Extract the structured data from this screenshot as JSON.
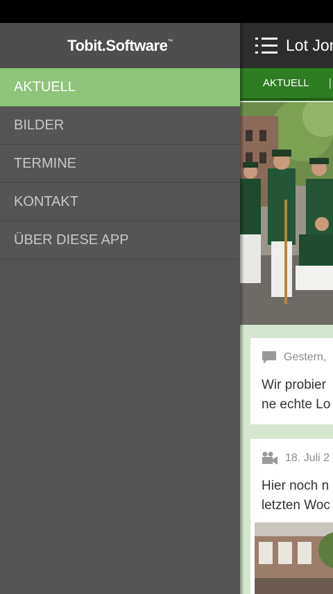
{
  "drawer": {
    "brand": "Tobit.Software",
    "brand_mark": "™",
    "items": [
      {
        "label": "AKTUELL",
        "active": true
      },
      {
        "label": "BILDER",
        "active": false
      },
      {
        "label": "TERMINE",
        "active": false
      },
      {
        "label": "KONTAKT",
        "active": false
      },
      {
        "label": "ÜBER DIESE APP",
        "active": false
      }
    ]
  },
  "appbar": {
    "menu_icon": "hamburger-menu-icon",
    "title": "Lot Jon"
  },
  "tabs": {
    "active_label": "AKTUELL",
    "separator": "|"
  },
  "feed": {
    "photo_alt_icon": "group-photo",
    "cards": [
      {
        "icon": "comment-icon",
        "date": "Gestern,",
        "text": "Wir probier\nne echte Lo"
      },
      {
        "icon": "video-camera-icon",
        "date": "18. Juli 2",
        "text": "Hier noch n\nletzten Woc"
      }
    ]
  },
  "colors": {
    "drawer_bg": "#555555",
    "active_item": "#8dc57a",
    "tabbar": "#2f7d23",
    "appbar": "#2d2d2d",
    "feed_bg": "#d4e6cf"
  }
}
